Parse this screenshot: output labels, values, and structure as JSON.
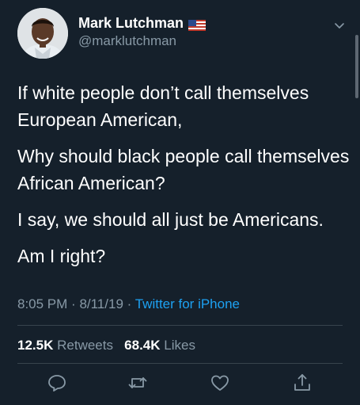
{
  "user": {
    "display_name": "Mark Lutchman",
    "handle": "@marklutchman",
    "flag_icon": "us-flag-icon"
  },
  "tweet": {
    "paragraphs": [
      "If white people don’t call themselves European American,",
      "Why should black people call themselves African American?",
      "I say, we should all just be Americans.",
      "Am I right?"
    ],
    "time": "8:05 PM",
    "date": "8/11/19",
    "source": "Twitter for iPhone"
  },
  "stats": {
    "retweets_count": "12.5K",
    "retweets_label": "Retweets",
    "likes_count": "68.4K",
    "likes_label": "Likes"
  },
  "actions": [
    "reply-icon",
    "retweet-icon",
    "like-icon",
    "share-icon"
  ],
  "colors": {
    "background": "#15202b",
    "secondary_text": "#8899a6",
    "link": "#1da1f2",
    "divider": "#38444d"
  }
}
